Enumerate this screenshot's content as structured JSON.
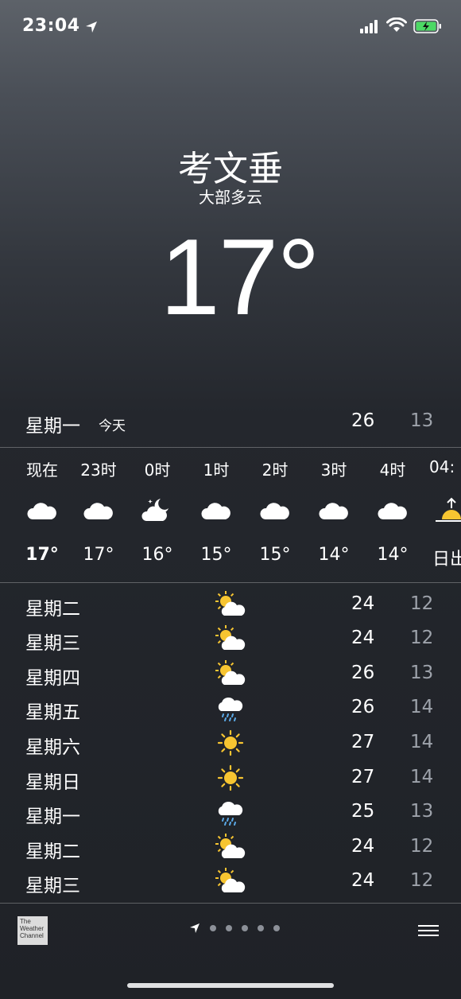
{
  "status_bar": {
    "time": "23:04"
  },
  "header": {
    "city": "考文垂",
    "condition": "大部多云",
    "temperature": "17°"
  },
  "today": {
    "day": "星期一",
    "label": "今天",
    "high": "26",
    "low": "13"
  },
  "hourly": [
    {
      "time": "现在",
      "icon": "cloud-icon",
      "temp": "17°"
    },
    {
      "time": "23时",
      "icon": "cloud-icon",
      "temp": "17°"
    },
    {
      "time": "0时",
      "icon": "cloud-moon-icon",
      "temp": "16°"
    },
    {
      "time": "1时",
      "icon": "cloud-icon",
      "temp": "15°"
    },
    {
      "time": "2时",
      "icon": "cloud-icon",
      "temp": "15°"
    },
    {
      "time": "3时",
      "icon": "cloud-icon",
      "temp": "14°"
    },
    {
      "time": "4时",
      "icon": "cloud-icon",
      "temp": "14°"
    },
    {
      "time": "04:",
      "icon": "sunrise-icon",
      "temp": "日出"
    }
  ],
  "daily": [
    {
      "day": "星期二",
      "icon": "partly-sunny-icon",
      "high": "24",
      "low": "12"
    },
    {
      "day": "星期三",
      "icon": "partly-sunny-icon",
      "high": "24",
      "low": "12"
    },
    {
      "day": "星期四",
      "icon": "partly-sunny-icon",
      "high": "26",
      "low": "13"
    },
    {
      "day": "星期五",
      "icon": "rain-cloud-icon",
      "high": "26",
      "low": "14"
    },
    {
      "day": "星期六",
      "icon": "sun-icon",
      "high": "27",
      "low": "14"
    },
    {
      "day": "星期日",
      "icon": "sun-icon",
      "high": "27",
      "low": "14"
    },
    {
      "day": "星期一",
      "icon": "rain-cloud-icon",
      "high": "25",
      "low": "13"
    },
    {
      "day": "星期二",
      "icon": "partly-sunny-icon",
      "high": "24",
      "low": "12"
    },
    {
      "day": "星期三",
      "icon": "partly-sunny-icon",
      "high": "24",
      "low": "12"
    }
  ],
  "footer": {
    "weather_channel_logo": "The Weather Channel",
    "page_count": 5,
    "current_page": 1
  },
  "colors": {
    "low_temp": "#9ea3ab",
    "sun": "#f7c531",
    "rain": "#5aa9e6"
  }
}
